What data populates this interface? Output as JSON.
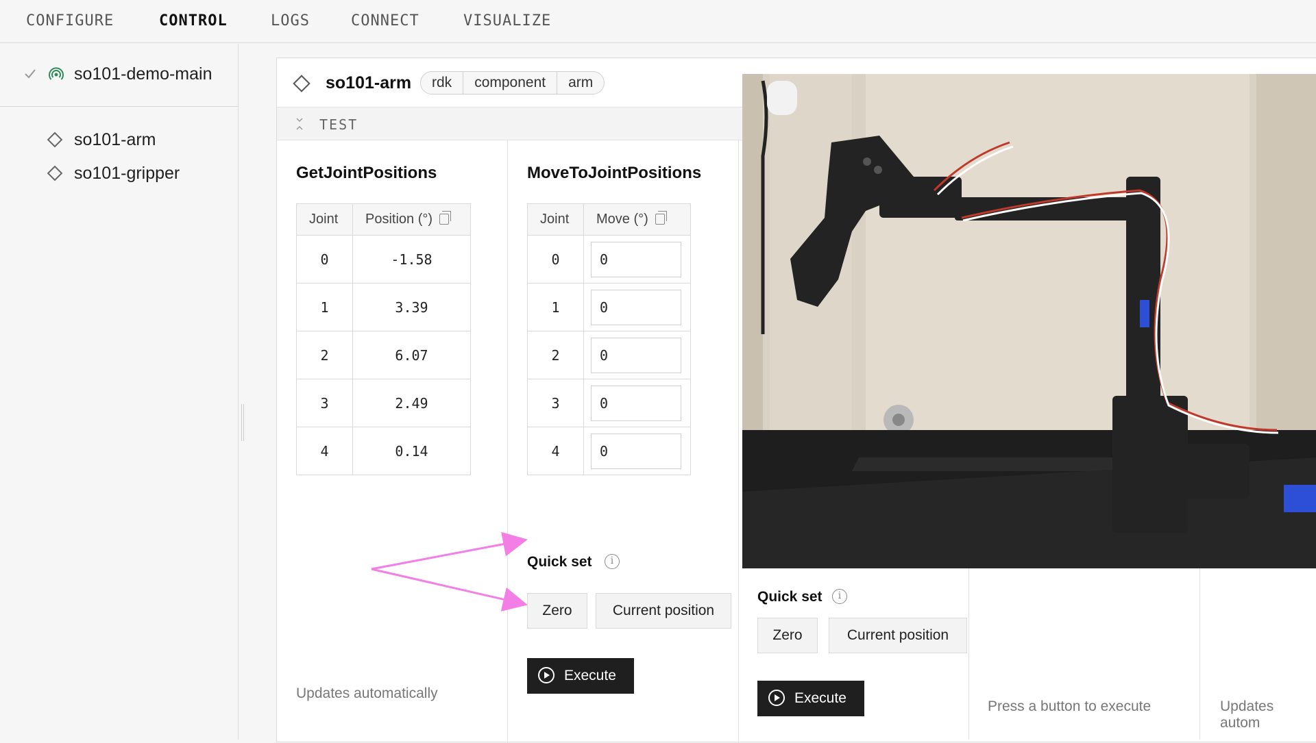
{
  "nav": {
    "tabs": [
      {
        "label": "CONFIGURE"
      },
      {
        "label": "CONTROL"
      },
      {
        "label": "LOGS"
      },
      {
        "label": "CONNECT"
      },
      {
        "label": "VISUALIZE"
      }
    ],
    "active": "CONTROL"
  },
  "sidebar": {
    "machine": "so101-demo-main",
    "items": [
      {
        "label": "so101-arm"
      },
      {
        "label": "so101-gripper"
      }
    ]
  },
  "card": {
    "title": "so101-arm",
    "breadcrumb": [
      "rdk",
      "component",
      "arm"
    ],
    "section_label": "TEST"
  },
  "get_joints": {
    "title": "GetJointPositions",
    "headers": [
      "Joint",
      "Position (°)"
    ],
    "rows": [
      {
        "joint": "0",
        "value": "-1.58"
      },
      {
        "joint": "1",
        "value": "3.39"
      },
      {
        "joint": "2",
        "value": "6.07"
      },
      {
        "joint": "3",
        "value": "2.49"
      },
      {
        "joint": "4",
        "value": "0.14"
      }
    ],
    "footer": "Updates automatically"
  },
  "move_joints": {
    "title": "MoveToJointPositions",
    "headers": [
      "Joint",
      "Move (°)"
    ],
    "rows": [
      {
        "joint": "0",
        "value": "0"
      },
      {
        "joint": "1",
        "value": "0"
      },
      {
        "joint": "2",
        "value": "0"
      },
      {
        "joint": "3",
        "value": "0"
      },
      {
        "joint": "4",
        "value": "0"
      }
    ],
    "quick_set_label": "Quick set",
    "zero_label": "Zero",
    "current_position_label": "Current position",
    "execute_label": "Execute"
  },
  "lower_panel": {
    "quick_set_label": "Quick set",
    "zero_label": "Zero",
    "current_position_label": "Current position",
    "execute_label": "Execute",
    "press_note": "Press a button to execute",
    "updates_note": "Updates autom"
  },
  "colors": {
    "annotation_arrow": "#f27ee6",
    "execute_bg": "#1f1f1f",
    "live_green": "#2e8b57"
  }
}
